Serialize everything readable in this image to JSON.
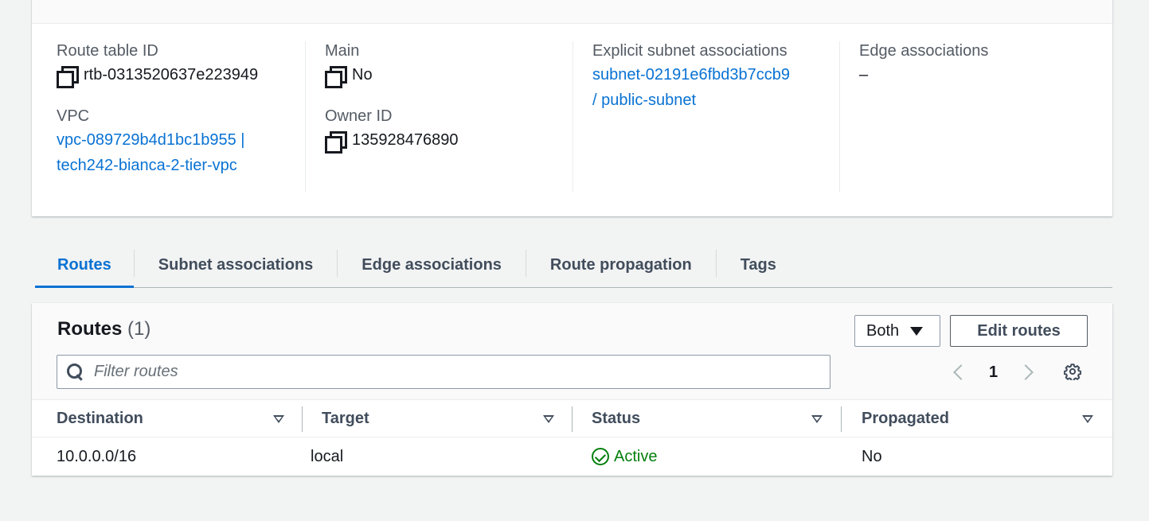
{
  "details": {
    "route_table_id_label": "Route table ID",
    "route_table_id": "rtb-0313520637e223949",
    "vpc_label": "VPC",
    "vpc_line1": "vpc-089729b4d1bc1b955 |",
    "vpc_line2": "tech242-bianca-2-tier-vpc",
    "main_label": "Main",
    "main_value": "No",
    "owner_label": "Owner ID",
    "owner_value": "135928476890",
    "explicit_label": "Explicit subnet associations",
    "explicit_line1": "subnet-02191e6fbd3b7ccb9",
    "explicit_line2": "/ public-subnet",
    "edge_label": "Edge associations",
    "edge_value": "–"
  },
  "tabs": [
    {
      "label": "Routes",
      "active": true
    },
    {
      "label": "Subnet associations",
      "active": false
    },
    {
      "label": "Edge associations",
      "active": false
    },
    {
      "label": "Route propagation",
      "active": false
    },
    {
      "label": "Tags",
      "active": false
    }
  ],
  "routes": {
    "title": "Routes",
    "count": "(1)",
    "filter_select": "Both",
    "edit_button": "Edit routes",
    "filter_placeholder": "Filter routes",
    "page": "1",
    "columns": [
      "Destination",
      "Target",
      "Status",
      "Propagated"
    ],
    "rows": [
      {
        "destination": "10.0.0.0/16",
        "target": "local",
        "status": "Active",
        "propagated": "No"
      }
    ]
  },
  "colors": {
    "link": "#0972d3",
    "success": "#037f0c",
    "page_bg": "#f2f3f3"
  },
  "icons": [
    "copy-icon",
    "search-icon",
    "chevron-left-icon",
    "chevron-right-icon",
    "settings-gear-icon",
    "caret-down-icon",
    "sort-icon",
    "status-check-icon"
  ]
}
